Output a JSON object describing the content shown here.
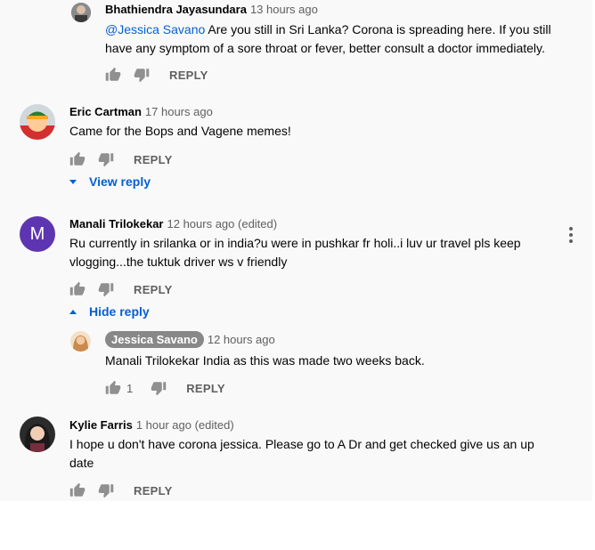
{
  "comments": [
    {
      "author": "Bhathiendra Jayasundara",
      "time": "13 hours ago",
      "mention": "@Jessica Savano",
      "text_line1": " Are you still in Sri Lanka? Corona is spreading here. If you still",
      "text_line2": "have any symptom of a sore throat or fever, better consult a doctor immediately.",
      "reply_label": "REPLY"
    },
    {
      "author": "Eric Cartman",
      "time": "17 hours ago",
      "text": "Came for the Bops and Vagene memes!",
      "reply_label": "REPLY",
      "toggle_label": "View reply"
    },
    {
      "author": "Manali Trilokekar",
      "avatar_letter": "M",
      "time": "12 hours ago (edited)",
      "text_line1": "Ru currently in srilanka or in india?u were in pushkar fr holi..i luv ur travel pls keep",
      "text_line2": "vlogging...the tuktuk driver ws v friendly",
      "reply_label": "REPLY",
      "toggle_label": "Hide reply"
    },
    {
      "author": "Jessica Savano",
      "time": "12 hours ago",
      "text": "Manali Trilokekar India as this was made two weeks back.",
      "likes": "1",
      "reply_label": "REPLY"
    },
    {
      "author": "Kylie Farris",
      "time": "1 hour ago (edited)",
      "text_line1": "I hope u don't have corona jessica. Please go to A Dr and get checked give us an up",
      "text_line2": "date",
      "reply_label": "REPLY"
    }
  ],
  "icons": [
    "thumb-up-icon",
    "thumb-down-icon",
    "caret-down-icon",
    "caret-up-icon",
    "more-vert-icon"
  ],
  "colors": {
    "link": "#065fd4",
    "meta": "#606060",
    "avatar_m": "#5e35b1",
    "owner_chip": "#888888"
  }
}
